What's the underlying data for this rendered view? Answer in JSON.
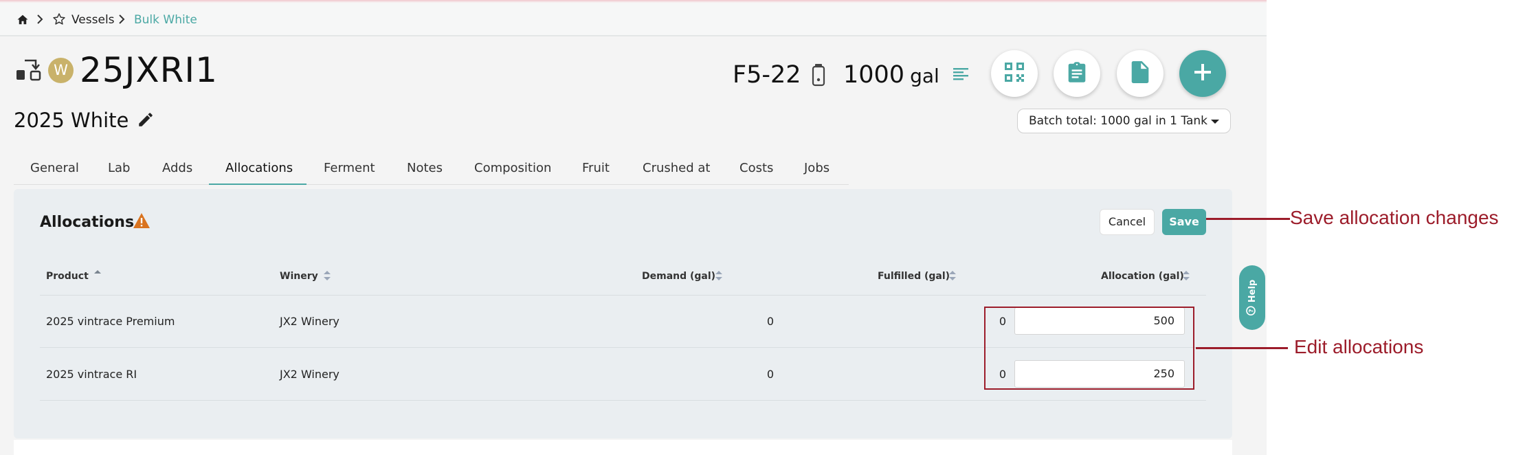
{
  "breadcrumb": {
    "home_icon": "home-icon",
    "star_icon": "star-icon",
    "vessels_label": "Vessels",
    "current_label": "Bulk White"
  },
  "header": {
    "vessel_code": "25JXRI1",
    "badge_letter": "W",
    "batch_name": "2025 White",
    "tank": "F5-22",
    "volume": "1000",
    "volume_unit": "gal",
    "batch_total": "Batch total: 1000 gal in 1 Tank"
  },
  "tabs": [
    {
      "label": "General"
    },
    {
      "label": "Lab"
    },
    {
      "label": "Adds"
    },
    {
      "label": "Allocations"
    },
    {
      "label": "Ferment"
    },
    {
      "label": "Notes"
    },
    {
      "label": "Composition"
    },
    {
      "label": "Fruit"
    },
    {
      "label": "Crushed at"
    },
    {
      "label": "Costs"
    },
    {
      "label": "Jobs"
    }
  ],
  "active_tab": "Allocations",
  "allocations": {
    "title": "Allocations",
    "cancel_label": "Cancel",
    "save_label": "Save",
    "columns": [
      "Product",
      "Winery",
      "Demand (gal)",
      "Fulfilled (gal)",
      "Allocation (gal)"
    ],
    "rows": [
      {
        "product": "2025 vintrace Premium",
        "winery": "JX2 Winery",
        "demand": "0",
        "fulfilled": "0",
        "allocation": "500"
      },
      {
        "product": "2025 vintrace RI",
        "winery": "JX2 Winery",
        "demand": "0",
        "fulfilled": "0",
        "allocation": "250"
      }
    ]
  },
  "help_label": "Help",
  "annotations": {
    "save_callout": "Save allocation changes",
    "edit_callout": "Edit allocations"
  },
  "colors": {
    "accent": "#4aa8a4",
    "warning": "#d9731f",
    "callout": "#9c1c2a",
    "badge": "#c9b26a"
  }
}
